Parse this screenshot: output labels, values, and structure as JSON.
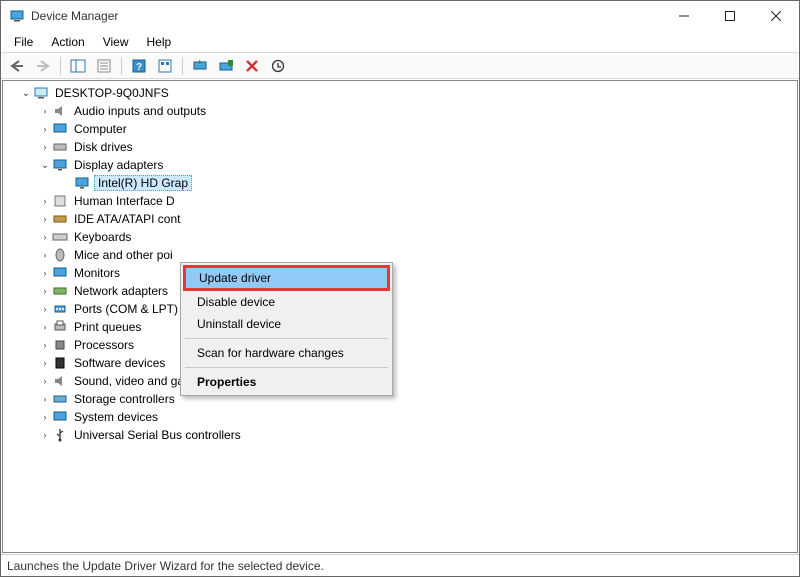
{
  "title": "Device Manager",
  "menu": {
    "file": "File",
    "action": "Action",
    "view": "View",
    "help": "Help"
  },
  "root": "DESKTOP-9Q0JNFS",
  "nodes": {
    "audio": "Audio inputs and outputs",
    "computer": "Computer",
    "disk": "Disk drives",
    "display": "Display adapters",
    "intel": "Intel(R) HD Grap",
    "hid": "Human Interface D",
    "ide": "IDE ATA/ATAPI cont",
    "keyboards": "Keyboards",
    "mice": "Mice and other poi",
    "monitors": "Monitors",
    "network": "Network adapters",
    "ports": "Ports (COM & LPT)",
    "printq": "Print queues",
    "processors": "Processors",
    "software": "Software devices",
    "sound": "Sound, video and game controllers",
    "storage": "Storage controllers",
    "system": "System devices",
    "usb": "Universal Serial Bus controllers"
  },
  "context": {
    "update": "Update driver",
    "disable": "Disable device",
    "uninstall": "Uninstall device",
    "scan": "Scan for hardware changes",
    "properties": "Properties"
  },
  "status": "Launches the Update Driver Wizard for the selected device."
}
